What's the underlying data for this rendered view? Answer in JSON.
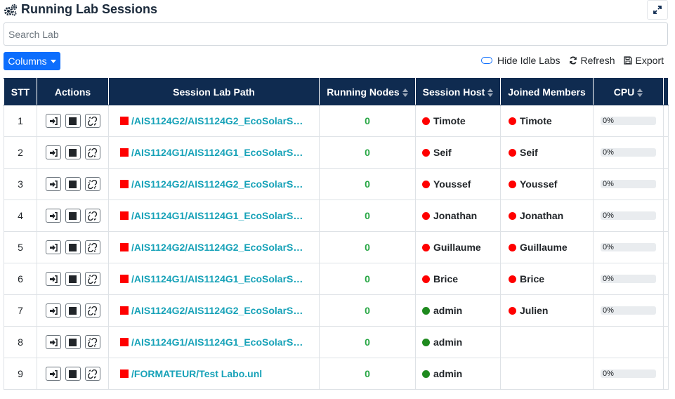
{
  "header": {
    "title": "Running Lab Sessions"
  },
  "search": {
    "placeholder": "Search Lab",
    "value": ""
  },
  "toolbar": {
    "columns_label": "Columns",
    "hide_idle_label": "Hide Idle Labs",
    "refresh_label": "Refresh",
    "export_label": "Export"
  },
  "table": {
    "headers": {
      "stt": "STT",
      "actions": "Actions",
      "path": "Session Lab Path",
      "nodes": "Running Nodes",
      "host": "Session Host",
      "members": "Joined Members",
      "cpu": "CPU"
    },
    "rows": [
      {
        "stt": "1",
        "path": "/AIS1124G2/AIS1124G2_EcoSolarS…",
        "nodes": "0",
        "host": "Timote",
        "host_status": "red",
        "member": "Timote",
        "member_status": "red",
        "cpu": "0%",
        "cpu_fraction": 0
      },
      {
        "stt": "2",
        "path": "/AIS1124G1/AIS1124G1_EcoSolarS…",
        "nodes": "0",
        "host": "Seif",
        "host_status": "red",
        "member": "Seif",
        "member_status": "red",
        "cpu": "0%",
        "cpu_fraction": 0
      },
      {
        "stt": "3",
        "path": "/AIS1124G2/AIS1124G2_EcoSolarS…",
        "nodes": "0",
        "host": "Youssef",
        "host_status": "red",
        "member": "Youssef",
        "member_status": "red",
        "cpu": "0%",
        "cpu_fraction": 0
      },
      {
        "stt": "4",
        "path": "/AIS1124G1/AIS1124G1_EcoSolarS…",
        "nodes": "0",
        "host": "Jonathan",
        "host_status": "red",
        "member": "Jonathan",
        "member_status": "red",
        "cpu": "0%",
        "cpu_fraction": 0
      },
      {
        "stt": "5",
        "path": "/AIS1124G2/AIS1124G2_EcoSolarS…",
        "nodes": "0",
        "host": "Guillaume",
        "host_status": "red",
        "member": "Guillaume",
        "member_status": "red",
        "cpu": "0%",
        "cpu_fraction": 0
      },
      {
        "stt": "6",
        "path": "/AIS1124G1/AIS1124G1_EcoSolarS…",
        "nodes": "0",
        "host": "Brice",
        "host_status": "red",
        "member": "Brice",
        "member_status": "red",
        "cpu": "0%",
        "cpu_fraction": 0
      },
      {
        "stt": "7",
        "path": "/AIS1124G2/AIS1124G2_EcoSolarS…",
        "nodes": "0",
        "host": "admin",
        "host_status": "green",
        "member": "Julien",
        "member_status": "red",
        "cpu": "0%",
        "cpu_fraction": 0
      },
      {
        "stt": "8",
        "path": "/AIS1124G1/AIS1124G1_EcoSolarS…",
        "nodes": "0",
        "host": "admin",
        "host_status": "green",
        "member": "",
        "member_status": "",
        "cpu": "",
        "cpu_fraction": null
      },
      {
        "stt": "9",
        "path": "/FORMATEUR/Test Labo.unl",
        "nodes": "0",
        "host": "admin",
        "host_status": "green",
        "member": "",
        "member_status": "",
        "cpu": "0%",
        "cpu_fraction": 0
      }
    ]
  },
  "colors": {
    "header_bg": "#0f2b50",
    "primary": "#0d6efd",
    "link": "#17a2b8",
    "status_red": "#ff0000",
    "status_green": "#1e8a1e",
    "nodes_green": "#28a745"
  },
  "icons": {
    "title": "gears-icon",
    "expand": "expand-icon",
    "join": "sign-in-icon",
    "stop": "stop-icon",
    "unlink": "unlink-icon",
    "refresh": "refresh-icon",
    "export": "save-icon",
    "sort": "sort-icon"
  }
}
